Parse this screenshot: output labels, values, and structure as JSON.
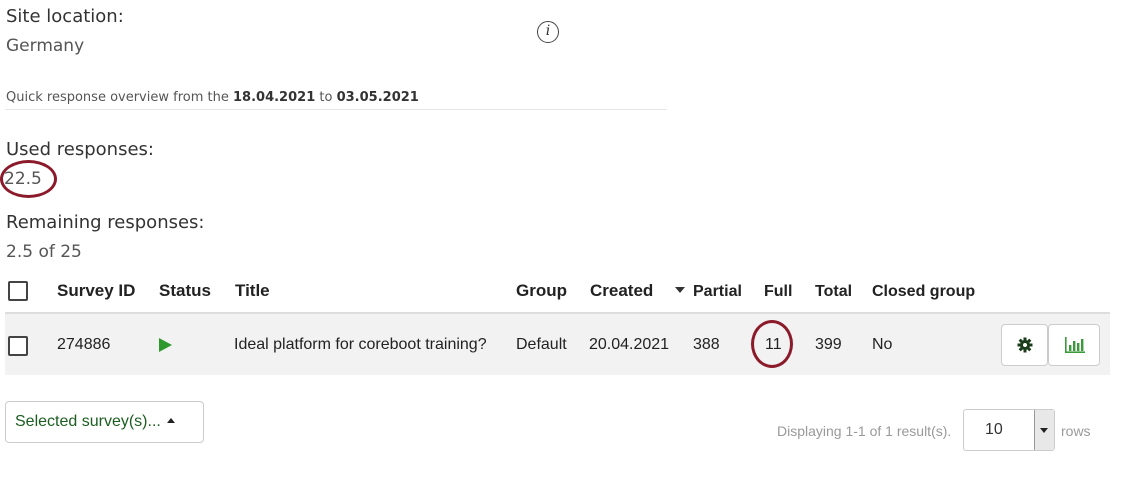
{
  "site": {
    "label": "Site location:",
    "value": "Germany"
  },
  "info_icon_glyph": "i",
  "quick_overview": {
    "prefix": "Quick response overview from the",
    "from": "18.04.2021",
    "to_word": "to",
    "to": "03.05.2021"
  },
  "used": {
    "label": "Used responses:",
    "value": "22.5"
  },
  "remaining": {
    "label": "Remaining responses:",
    "value": "2.5 of 25"
  },
  "table": {
    "headers": {
      "survey_id": "Survey ID",
      "status": "Status",
      "title": "Title",
      "group": "Group",
      "created": "Created",
      "partial": "Partial",
      "full": "Full",
      "total": "Total",
      "closed_group": "Closed group"
    },
    "sort_column": "Created",
    "rows": [
      {
        "survey_id": "274886",
        "status": "active",
        "title": "Ideal platform for coreboot training?",
        "group": "Default",
        "created": "20.04.2021",
        "partial": "388",
        "full": "11",
        "total": "399",
        "closed_group": "No"
      }
    ]
  },
  "row_actions": {
    "settings_icon": "gear-icon",
    "stats_icon": "bar-chart-icon"
  },
  "selected_button": {
    "label": "Selected survey(s)..."
  },
  "pagination": {
    "summary": "Displaying 1-1 of 1 result(s).",
    "page_size": "10",
    "rows_label": "rows"
  },
  "colors": {
    "highlight_circle": "#8b1a2b",
    "active_play": "#2e9a2e",
    "action_green": "#1b5e20"
  }
}
